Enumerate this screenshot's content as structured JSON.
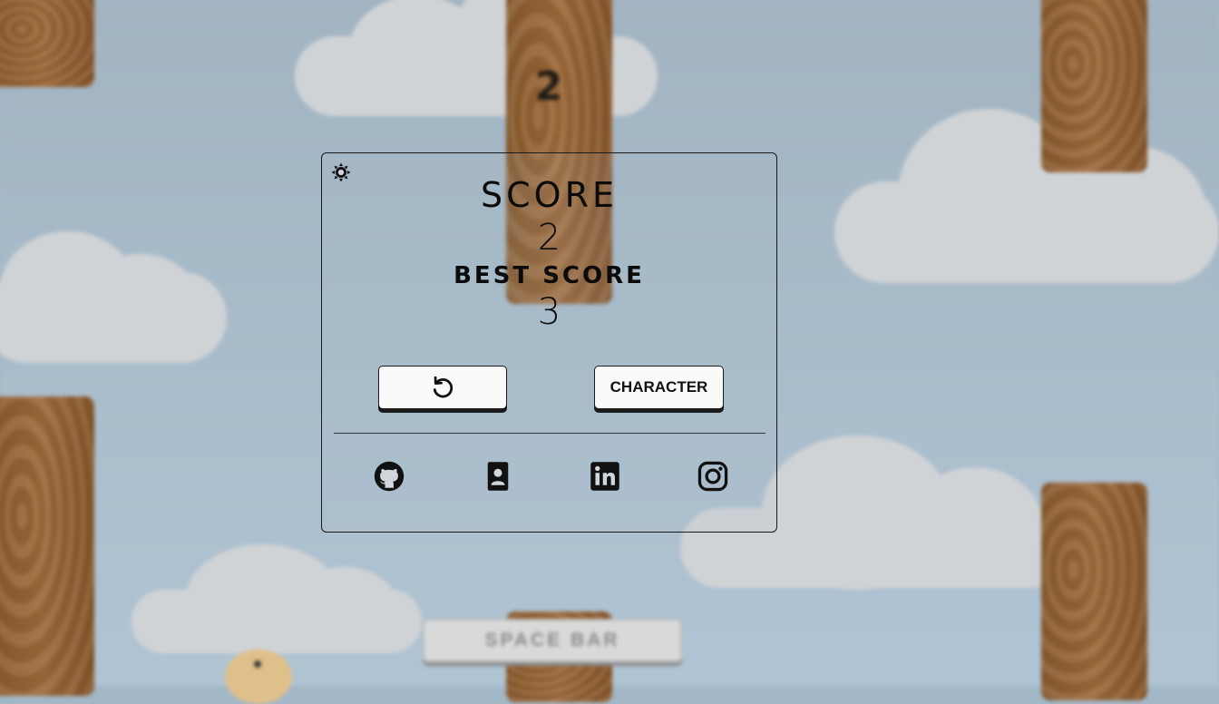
{
  "game": {
    "current_score": "2",
    "space_bar_label": "SPACE BAR"
  },
  "panel": {
    "score_label": "SCORE",
    "score_value": "2",
    "best_label": "BEST SCORE",
    "best_value": "3",
    "character_button_label": "CHARACTER",
    "restart_icon": "restart-icon",
    "theme_icon": "sun-icon",
    "social_icons": [
      "github-icon",
      "contact-card-icon",
      "linkedin-icon",
      "instagram-icon"
    ]
  },
  "colors": {
    "sky": "#a3b8c7",
    "pipe": "#9e6a3a",
    "cloud": "#d0d3d6",
    "text": "#0b0b0b"
  }
}
